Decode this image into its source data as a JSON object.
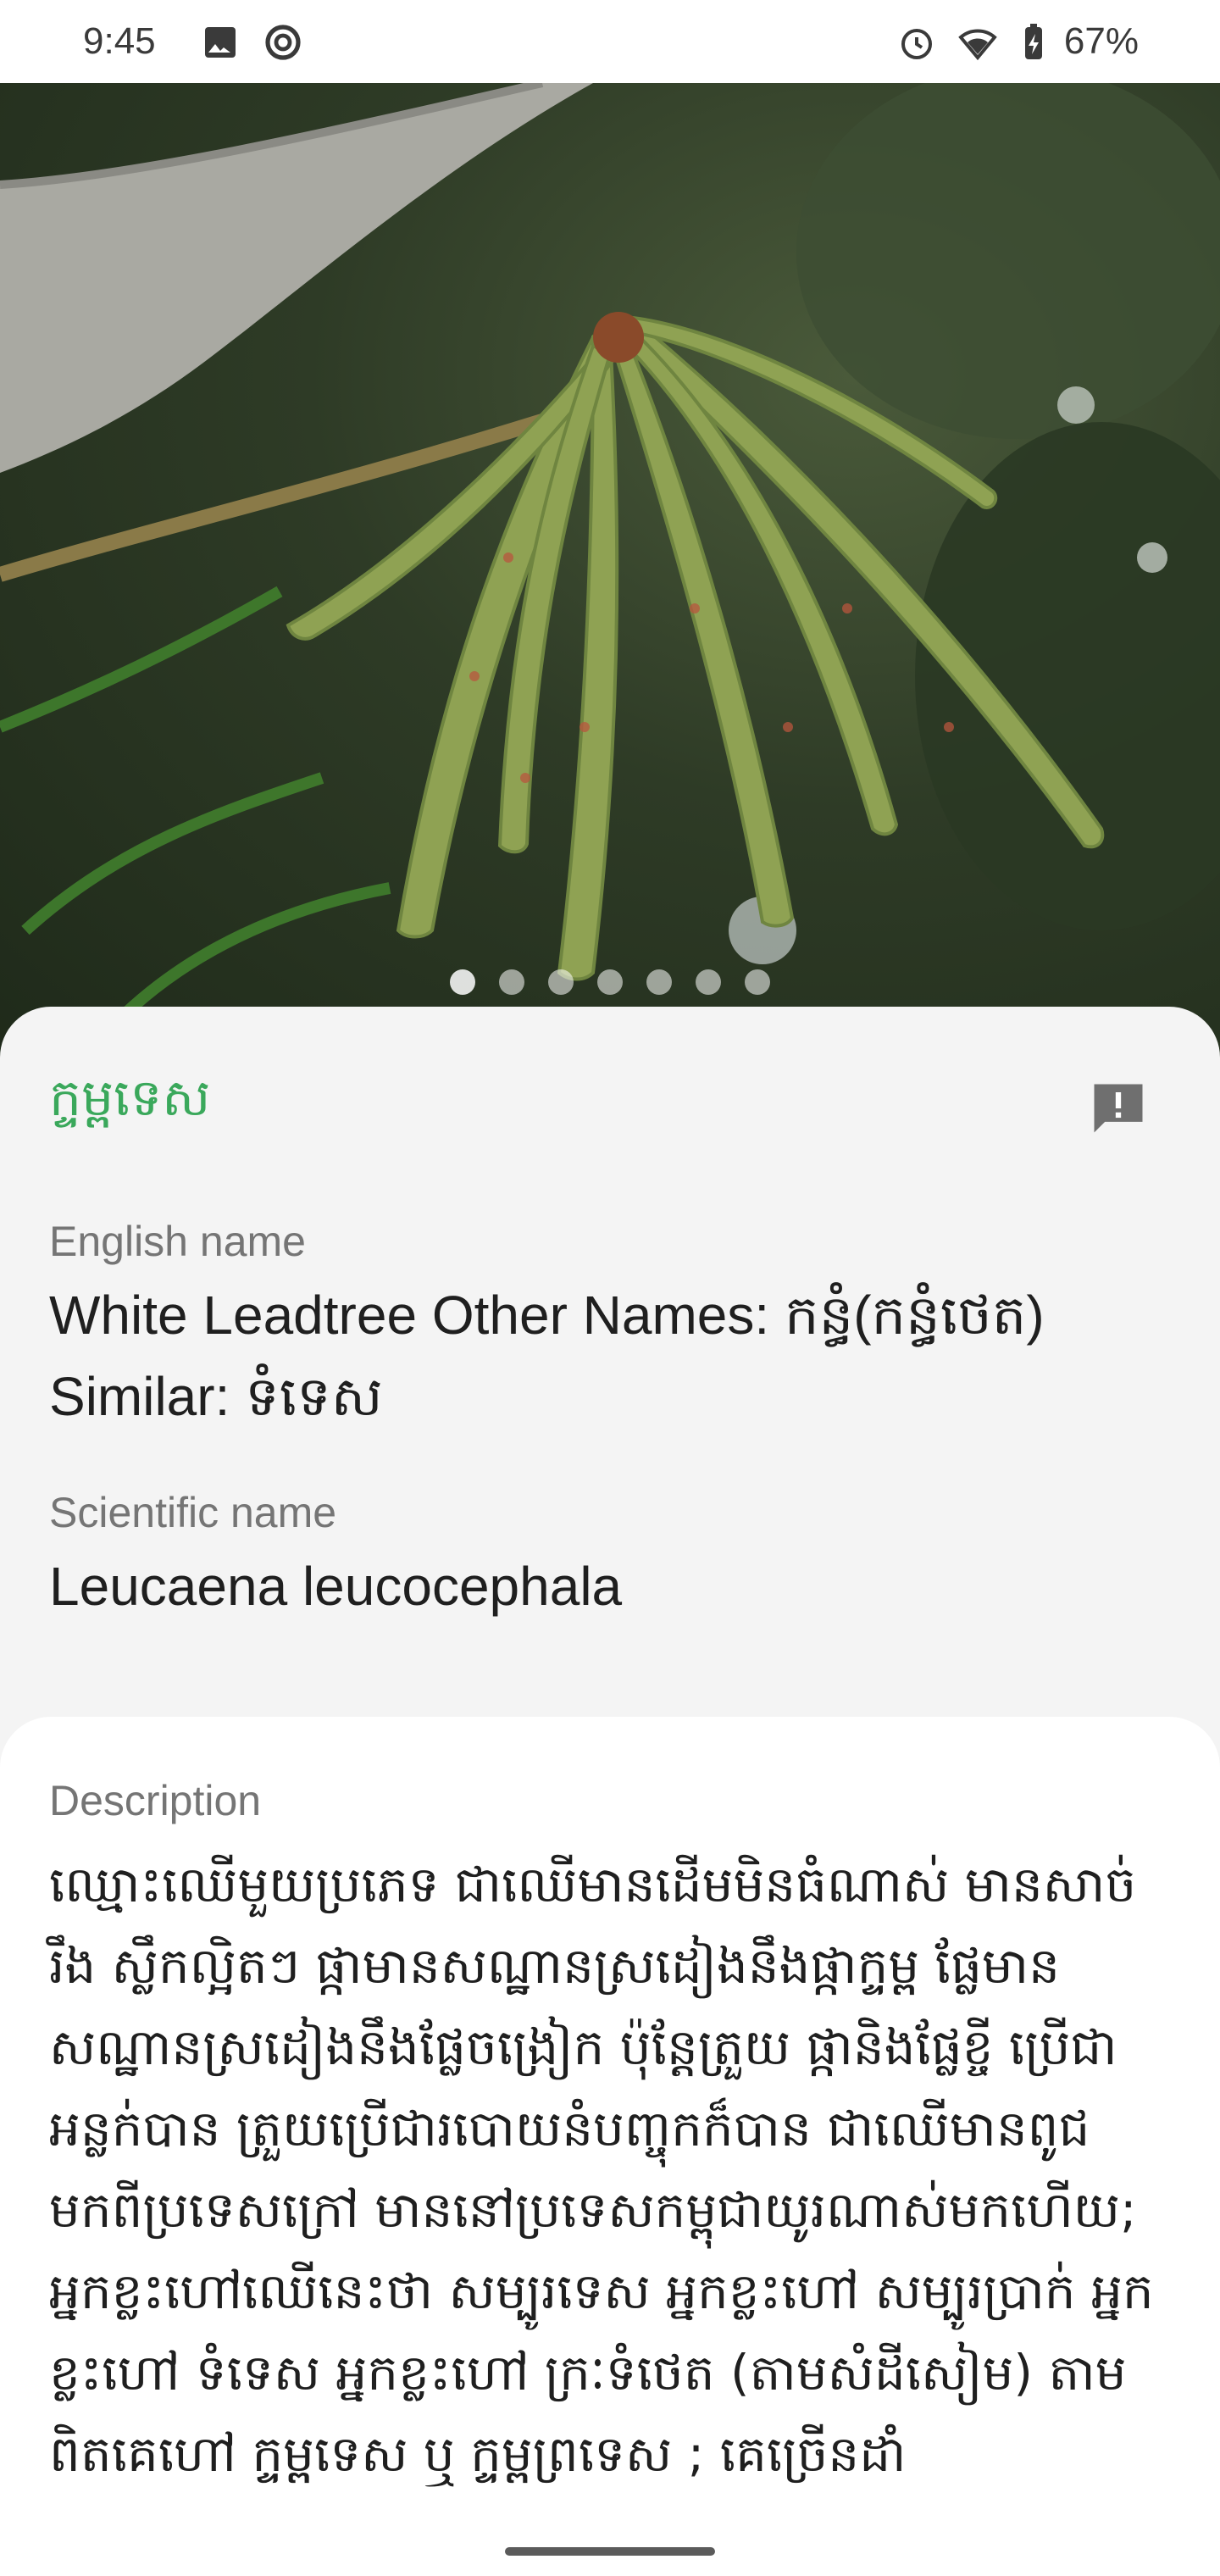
{
  "status_bar": {
    "time": "9:45",
    "battery": "67%",
    "icons": [
      "image-icon",
      "sync-icon",
      "alarm-icon",
      "wifi-icon",
      "battery-icon"
    ]
  },
  "plant": {
    "khmer_name": "ក្ទម្ពទេស",
    "english_label": "English name",
    "english_line1_bold": "White Leadtree Other Names:",
    "english_line1_khmer": " កន្ធំ(កន្ធំថេត)",
    "english_line2_bold": "Similar:",
    "english_line2_khmer": " ទំទេស",
    "scientific_label": "Scientific name",
    "scientific_name": "Leucaena leucocephala",
    "description_label": "Description",
    "description": "ឈ្មោះឈើមួយប្រភេទ ជាឈើមានដើមមិនធំណាស់ មានសាច់រឹង ស្លឹកល្អិតៗ ផ្កាមានសណ្ឋានស្រដៀងនឹងផ្កាក្ទម្ព ផ្លែមានសណ្ឋានស្រដៀងនឹងផ្លែចង្រៀក ប៉ុន្តែត្រួយ ផ្កានិងផ្លែខ្ចី ប្រើជាអន្លក់បាន ត្រួយប្រើជារបោយនំបញ្ចុកក៏បាន ជាឈើមានពូជមកពីប្រទេសក្រៅ មាននៅប្រទេសកម្ពុជាយូរណាស់មកហើយ; អ្នកខ្លះហៅឈើនេះថា សម្បូរទេស អ្នកខ្លះហៅ សម្បូរប្រាក់ អ្នកខ្លះហៅ ទំទេស អ្នកខ្លះហៅ ក្រៈទំថេត (តាមសំដីសៀម) តាមពិតគេហៅ ក្ទម្ពទេស ឬ ក្ទម្ពព្រទេស ; គេច្រើនដាំ"
  },
  "carousel": {
    "count": 7,
    "active_index": 0
  },
  "colors": {
    "accent_green": "#3aa85b",
    "report_icon": "#6f6f6f"
  }
}
